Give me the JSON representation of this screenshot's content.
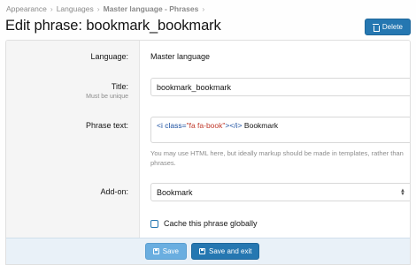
{
  "breadcrumb": {
    "items": [
      "Appearance",
      "Languages",
      "Master language - Phrases"
    ]
  },
  "header": {
    "title": "Edit phrase: bookmark_bookmark",
    "delete_label": "Delete"
  },
  "form": {
    "language": {
      "label": "Language:",
      "value": "Master language"
    },
    "title": {
      "label": "Title:",
      "hint": "Must be unique",
      "value": "bookmark_bookmark"
    },
    "phrase_text": {
      "label": "Phrase text:",
      "code_open_tag": "<i ",
      "code_attr": "class=",
      "code_str": "\"fa fa-book\"",
      "code_close": "></i>",
      "code_text": " Bookmark",
      "explain": "You may use HTML here, but ideally markup should be made in templates, rather than phrases."
    },
    "addon": {
      "label": "Add-on:",
      "selected": "Bookmark"
    },
    "cache": {
      "label": "Cache this phrase globally",
      "checked": false
    }
  },
  "actions": {
    "save_label": "Save",
    "save_exit_label": "Save and exit"
  }
}
